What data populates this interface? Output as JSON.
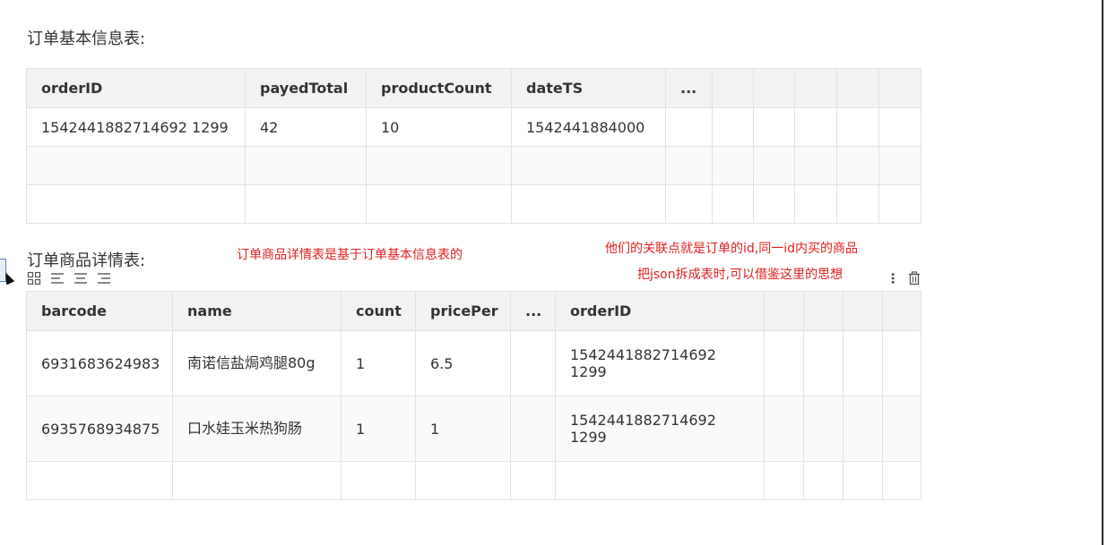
{
  "section1": {
    "heading": "订单基本信息表:",
    "columns": [
      "orderID",
      "payedTotal",
      "productCount",
      "dateTS",
      "...",
      "",
      "",
      "",
      "",
      ""
    ],
    "rows": [
      [
        "1542441882714692 1299",
        "42",
        "10",
        "1542441884000",
        "",
        "",
        "",
        "",
        "",
        ""
      ],
      [
        "",
        "",
        "",
        "",
        "",
        "",
        "",
        "",
        "",
        ""
      ],
      [
        "",
        "",
        "",
        "",
        "",
        "",
        "",
        "",
        "",
        ""
      ]
    ]
  },
  "section2": {
    "heading": "订单商品详情表:",
    "columns": [
      "barcode",
      "name",
      "count",
      "pricePer",
      "...",
      "orderID",
      "",
      "",
      "",
      ""
    ],
    "rows": [
      [
        "6931683624983",
        "南诺信盐焗鸡腿80g",
        "1",
        "6.5",
        "",
        "1542441882714692 1299",
        "",
        "",
        "",
        ""
      ],
      [
        "6935768934875",
        "口水娃玉米热狗肠",
        "1",
        "1",
        "",
        "1542441882714692 1299",
        "",
        "",
        "",
        ""
      ],
      [
        "",
        "",
        "",
        "",
        "",
        "",
        "",
        "",
        "",
        ""
      ]
    ]
  },
  "annotations": {
    "note1": "订单商品详情表是基于订单基本信息表的",
    "note2": "他们的关联点就是订单的id,同一id内买的商品",
    "note3": "把json拆成表时,可以借鉴这里的思想"
  },
  "toolbar": {
    "left_icons": [
      "grid-icon",
      "align-left-icon",
      "align-center-icon",
      "align-right-icon"
    ],
    "right_icons": [
      "more-vertical-icon",
      "trash-icon"
    ]
  },
  "colors": {
    "header_bg": "#f2f2f2",
    "border": "#e2e2e2",
    "note": "#e02020"
  }
}
